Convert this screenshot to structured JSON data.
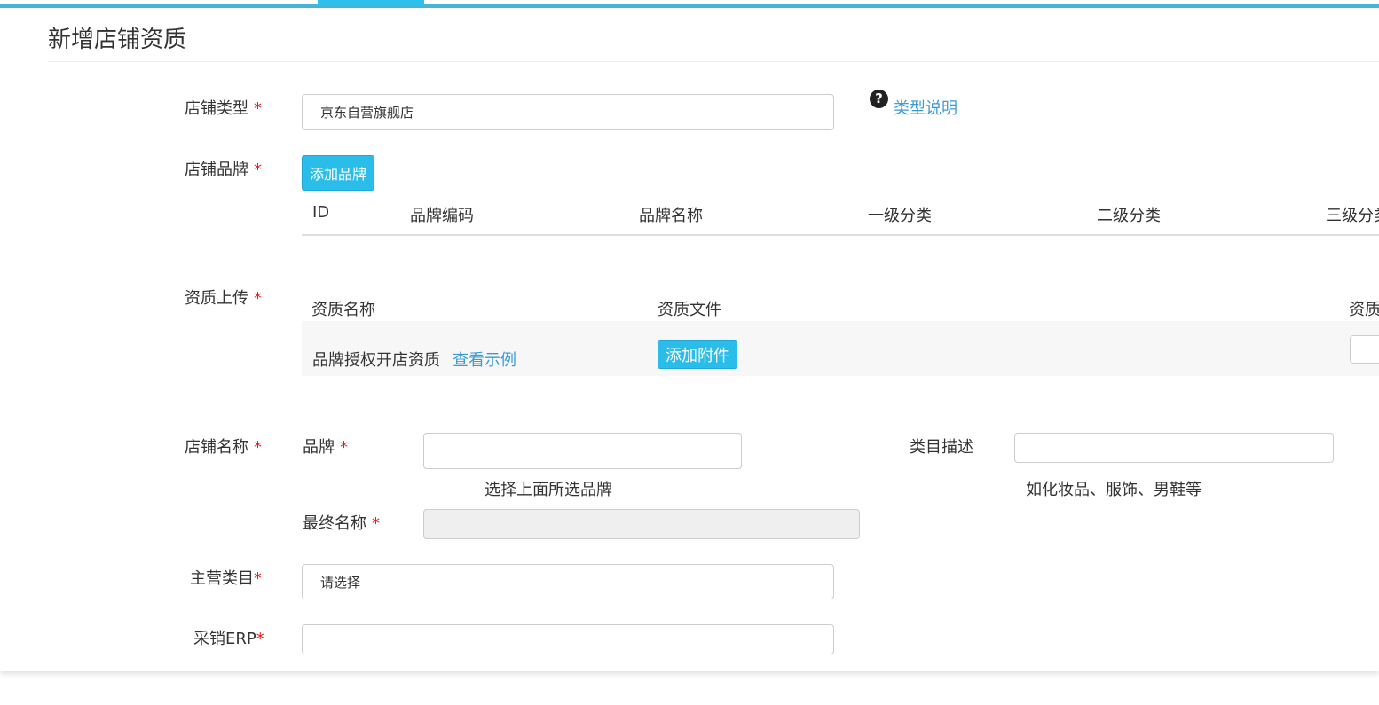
{
  "page": {
    "title": "新增店铺资质"
  },
  "shop_type": {
    "label": "店铺类型",
    "required": "*",
    "value": "京东自营旗舰店",
    "help_link": "类型说明",
    "help_icon": "question-circle-icon"
  },
  "shop_brand": {
    "label": "店铺品牌",
    "required": "*",
    "add_button": "添加品牌",
    "columns": [
      "ID",
      "品牌编码",
      "品牌名称",
      "一级分类",
      "二级分类",
      "三级分类"
    ]
  },
  "qualification": {
    "label": "资质上传",
    "required": "*",
    "columns": [
      "资质名称",
      "资质文件",
      "资质"
    ],
    "rows": [
      {
        "name": "品牌授权开店资质",
        "example_link": "查看示例",
        "upload_button": "添加附件"
      }
    ]
  },
  "shop_name": {
    "label": "店铺名称",
    "required": "*",
    "brand_label": "品牌",
    "brand_required": "*",
    "brand_value": "",
    "brand_hint": "选择上面所选品牌",
    "category_desc_label": "类目描述",
    "category_desc_value": "",
    "category_desc_hint": "如化妆品、服饰、男鞋等",
    "final_name_label": "最终名称",
    "final_name_required": "*",
    "final_name_value": ""
  },
  "main_category": {
    "label": "主营类目",
    "required": "*",
    "placeholder": "请选择"
  },
  "erp": {
    "label": "采销ERP",
    "required": "*",
    "value": ""
  },
  "colors": {
    "accent": "#2bbdea",
    "link": "#3a9bd5",
    "required": "#e02020",
    "top_border": "#45b6d9"
  }
}
